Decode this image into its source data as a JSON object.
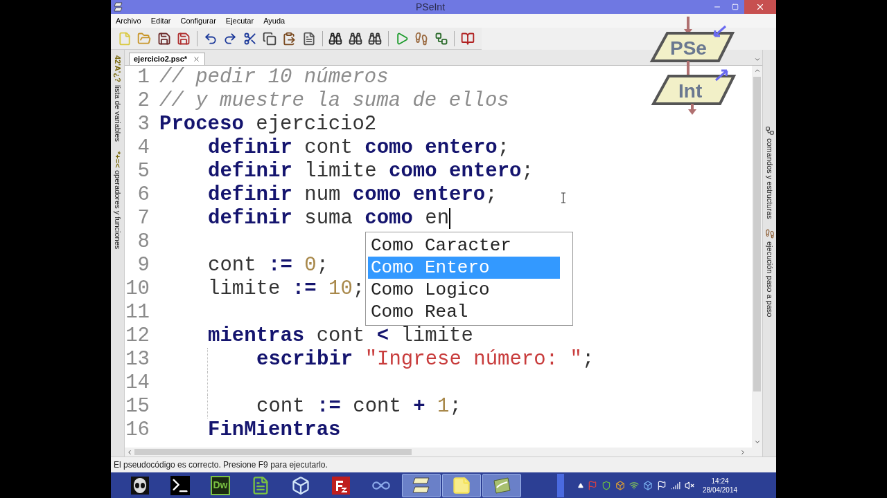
{
  "window": {
    "title": "PSeInt"
  },
  "menu": [
    "Archivo",
    "Editar",
    "Configurar",
    "Ejecutar",
    "Ayuda"
  ],
  "toolbar": [
    {
      "kind": "new"
    },
    {
      "kind": "open"
    },
    {
      "kind": "save"
    },
    {
      "kind": "save_as"
    },
    {
      "kind": "sep"
    },
    {
      "kind": "undo"
    },
    {
      "kind": "redo"
    },
    {
      "kind": "cut"
    },
    {
      "kind": "copy"
    },
    {
      "kind": "paste"
    },
    {
      "kind": "indent"
    },
    {
      "kind": "sep"
    },
    {
      "kind": "find"
    },
    {
      "kind": "find_prev"
    },
    {
      "kind": "find_next"
    },
    {
      "kind": "sep"
    },
    {
      "kind": "run"
    },
    {
      "kind": "step"
    },
    {
      "kind": "flowchart"
    },
    {
      "kind": "sep"
    },
    {
      "kind": "help"
    }
  ],
  "tabs": [
    {
      "label": "ejercicio2.psc*",
      "selected": true
    }
  ],
  "left_panel": [
    {
      "glyph": "42'A'¿?",
      "label": "lista de variables"
    },
    {
      "glyph": "*+=<",
      "label": "operadores y funciones"
    }
  ],
  "right_panel": [
    {
      "kind": "flowchart",
      "label": "comandos y estructuras"
    },
    {
      "kind": "steps",
      "label": "ejecución paso a paso"
    }
  ],
  "logo": {
    "top": "PSe",
    "bottom": "Int"
  },
  "editor": {
    "lines": [
      {
        "number": "1",
        "kind": "top",
        "tokens": [
          {
            "kind": "comment",
            "text": "// pedir 10 números"
          }
        ]
      },
      {
        "number": "2",
        "kind": "top",
        "tokens": [
          {
            "kind": "comment",
            "text": "// y muestre la suma de ellos"
          }
        ]
      },
      {
        "number": "3",
        "kind": "top",
        "tokens": [
          {
            "kind": "keyword",
            "text": "Proceso"
          },
          {
            "kind": "plain",
            "text": " ejercicio2"
          }
        ]
      },
      {
        "number": "4",
        "kind": "block",
        "tokens": [
          {
            "kind": "keyword",
            "text": "definir"
          },
          {
            "kind": "plain",
            "text": " cont "
          },
          {
            "kind": "keyword",
            "text": "como entero"
          },
          {
            "kind": "plain",
            "text": ";"
          }
        ]
      },
      {
        "number": "5",
        "kind": "block",
        "tokens": [
          {
            "kind": "keyword",
            "text": "definir"
          },
          {
            "kind": "plain",
            "text": " limite "
          },
          {
            "kind": "keyword",
            "text": "como entero"
          },
          {
            "kind": "plain",
            "text": ";"
          }
        ]
      },
      {
        "number": "6",
        "kind": "block",
        "tokens": [
          {
            "kind": "keyword",
            "text": "definir"
          },
          {
            "kind": "plain",
            "text": " num "
          },
          {
            "kind": "keyword",
            "text": "como entero"
          },
          {
            "kind": "plain",
            "text": ";"
          }
        ]
      },
      {
        "number": "7",
        "kind": "block",
        "tokens": [
          {
            "kind": "keyword",
            "text": "definir"
          },
          {
            "kind": "plain",
            "text": " suma "
          },
          {
            "kind": "keyword",
            "text": "como"
          },
          {
            "kind": "plain",
            "text": " en"
          },
          {
            "kind": "caret"
          }
        ]
      },
      {
        "number": "8",
        "kind": "block"
      },
      {
        "number": "9",
        "kind": "block",
        "tokens": [
          {
            "kind": "plain",
            "text": "cont "
          },
          {
            "kind": "keyword",
            "text": ":="
          },
          {
            "kind": "number",
            "text": " 0"
          },
          {
            "kind": "plain",
            "text": ";"
          }
        ]
      },
      {
        "number": "10",
        "kind": "block",
        "tokens": [
          {
            "kind": "plain",
            "text": "limite "
          },
          {
            "kind": "keyword",
            "text": ":="
          },
          {
            "kind": "number",
            "text": " 10"
          },
          {
            "kind": "plain",
            "text": ";"
          }
        ]
      },
      {
        "number": "11",
        "kind": "block"
      },
      {
        "number": "12",
        "kind": "block",
        "tokens": [
          {
            "kind": "keyword",
            "text": "mientras"
          },
          {
            "kind": "plain",
            "text": " cont "
          },
          {
            "kind": "keyword",
            "text": "<"
          },
          {
            "kind": "plain",
            "text": " limite"
          }
        ]
      },
      {
        "number": "13",
        "kind": "nested",
        "tokens": [
          {
            "kind": "keyword",
            "text": "escribir"
          },
          {
            "kind": "string",
            "text": " \"Ingrese número: \""
          },
          {
            "kind": "plain",
            "text": ";"
          }
        ]
      },
      {
        "number": "14",
        "kind": "nested"
      },
      {
        "number": "15",
        "kind": "nested",
        "tokens": [
          {
            "kind": "plain",
            "text": "cont "
          },
          {
            "kind": "keyword",
            "text": ":="
          },
          {
            "kind": "plain",
            "text": " cont "
          },
          {
            "kind": "keyword",
            "text": "+"
          },
          {
            "kind": "number",
            "text": " 1"
          },
          {
            "kind": "plain",
            "text": ";"
          }
        ]
      },
      {
        "number": "16",
        "kind": "block",
        "tokens": [
          {
            "kind": "keyword",
            "text": "FinMientras"
          }
        ]
      }
    ]
  },
  "autocomplete": [
    {
      "label": "Como Caracter",
      "selected": false
    },
    {
      "label": "Como Entero",
      "selected": true
    },
    {
      "label": "Como Logico",
      "selected": false
    },
    {
      "label": "Como Real",
      "selected": false
    }
  ],
  "status_bar": "El pseudocódigo es correcto. Presione F9 para ejecutarlo.",
  "taskbar": {
    "apps": [
      {
        "kind": "mask",
        "active": false
      },
      {
        "kind": "terminal",
        "active": false
      },
      {
        "kind": "dreamweaver",
        "label": "Dw",
        "active": false
      },
      {
        "kind": "editor",
        "active": false
      },
      {
        "kind": "cube",
        "active": false
      },
      {
        "kind": "filezilla",
        "active": false
      },
      {
        "kind": "infinity",
        "active": false
      },
      {
        "kind": "pseint",
        "active": true
      },
      {
        "kind": "notes",
        "active": true
      },
      {
        "kind": "green",
        "active": true
      }
    ],
    "clock": {
      "time": "14:24",
      "date": "28/04/2014"
    }
  }
}
